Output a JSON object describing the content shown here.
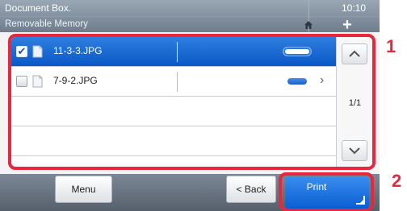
{
  "header": {
    "title": "Document Box.",
    "subtitle": "Removable Memory",
    "time": "10:10",
    "home_icon": "home-icon",
    "add_icon": "plus-icon",
    "add_glyph": "+"
  },
  "files": [
    {
      "name": "11-3-3.JPG",
      "checked": true,
      "check_glyph": "✔"
    },
    {
      "name": "7-9-2.JPG",
      "checked": false,
      "check_glyph": ""
    }
  ],
  "row2_chevron": "›",
  "pagination": {
    "page": "1/1"
  },
  "bottom": {
    "menu_label": "Menu",
    "back_label": "< Back",
    "print_label": "Print"
  },
  "callouts": {
    "list": "1",
    "print": "2"
  },
  "colors": {
    "selected_row": "#0b58c7",
    "highlight": "#e8273c",
    "print_button": "#1a6ee0"
  }
}
